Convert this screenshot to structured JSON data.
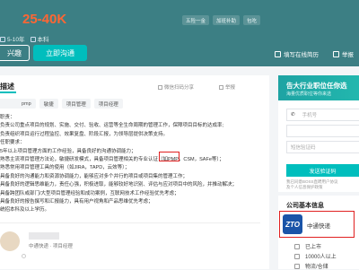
{
  "header": {
    "salary": "25-40K",
    "meta": [
      "5-10年",
      "本科"
    ],
    "interest_btn": "兴趣",
    "chat_btn": "立即沟通",
    "top_tags": [
      "五险一金",
      "加班补助",
      "包吃"
    ],
    "actions": [
      "填写在线简历",
      "举报"
    ]
  },
  "job": {
    "section_title": "描述",
    "links": [
      "微信扫码分享",
      "举报"
    ],
    "tags": [
      "pmp",
      "敏捷",
      "项目管理",
      "项目经理"
    ],
    "description": [
      "职责：",
      "负责公司重点项目的规划、实施、交付、验收、运营等全生命周期的管理工作，保障项目目标的达成率;",
      "负责组织项目运行过程监控、效果复盘、阶段汇报，为领导层提供决策支持。",
      "任职要求：",
      "5年以上项目管理方面的工作经验，具备良好的沟通协调能力；",
      "熟悉主流项目管理方法论，敏捷研发模式，具备项目管理相关的专业认证（如PMP，CSM，SAFe等）；",
      "熟悉常用项目管理工具的使用（如JIRA，TAPD，云效等）；",
      "具备良好的沟通能力和资源协调能力，能够应对多个并行的项目或项目集的管理工作；",
      "具备良好的逻辑思维能力，责任心强，积极进取，能够较好地识别、评估与应对项目中的风险，并推动解决；",
      "具备跨团队或部门/大型项目管理经验和成功案例，互联网技术工作经验优先考虑；",
      "具备良好的报告撰写和汇报能力，具有用户视角和产品思维优先考虑；",
      "统招本科及以上学历。"
    ],
    "recruiter_sub": "中通快递 · 项目经理"
  },
  "side": {
    "promo_title": "告大行业职位任你选",
    "promo_sub": "海量优质职位等你来选",
    "phone_placeholder": "手机号",
    "code_placeholder": "短信验证码",
    "send_btn": "发送验证码",
    "agree_line1": "我已同意BOSS直聘用户协议",
    "agree_line2": "及个人信息保护政策"
  },
  "company": {
    "section_title": "公司基本信息",
    "logo_text": "ZTO",
    "name": "中通快递",
    "items": [
      "已上市",
      "10000人以上",
      "物流/仓储"
    ]
  }
}
